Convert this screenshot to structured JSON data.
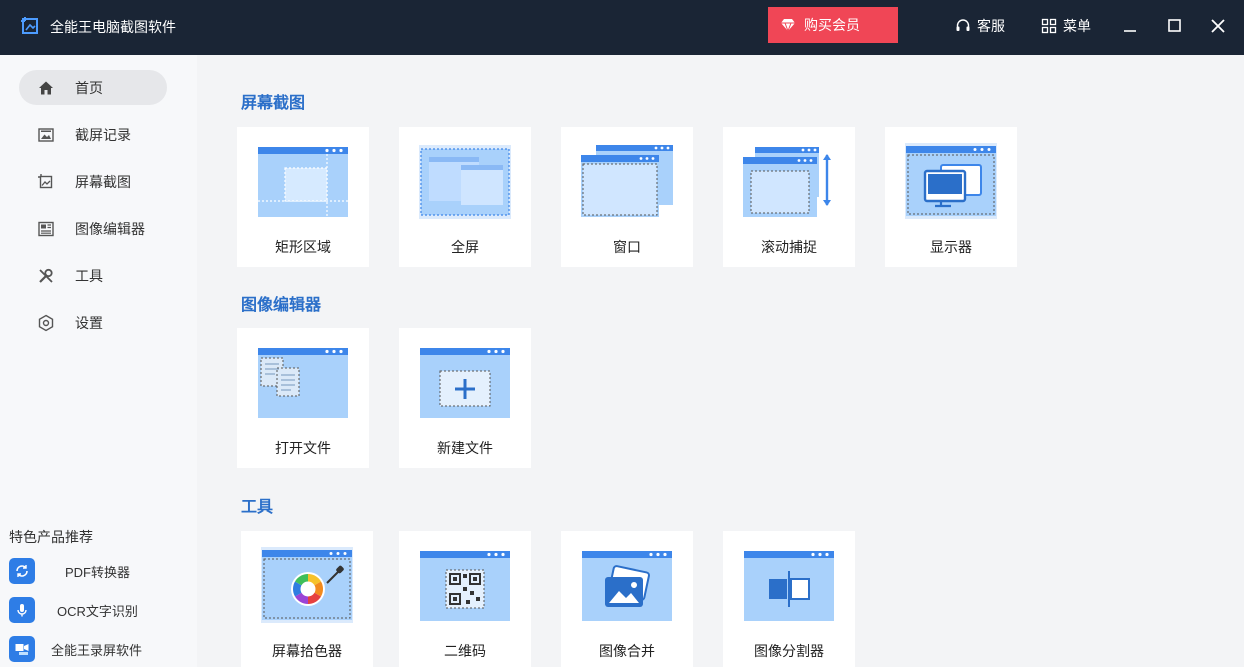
{
  "app": {
    "title": "全能王电脑截图软件",
    "vip_label": "购买会员",
    "service_label": "客服",
    "menu_label": "菜单"
  },
  "sidebar": {
    "items": [
      {
        "label": "首页",
        "icon": "home-icon",
        "active": true
      },
      {
        "label": "截屏记录",
        "icon": "history-icon"
      },
      {
        "label": "屏幕截图",
        "icon": "screenshot-icon"
      },
      {
        "label": "图像编辑器",
        "icon": "image-editor-icon"
      },
      {
        "label": "工具",
        "icon": "tools-icon"
      },
      {
        "label": "设置",
        "icon": "settings-icon"
      }
    ],
    "featured_title": "特色产品推荐",
    "featured": [
      {
        "label": "PDF转换器",
        "icon": "pdf-convert-icon"
      },
      {
        "label": "OCR文字识别",
        "icon": "microphone-icon"
      },
      {
        "label": "全能王录屏软件",
        "icon": "screen-record-icon"
      }
    ]
  },
  "main": {
    "sections": [
      {
        "title": "屏幕截图",
        "cards": [
          "矩形区域",
          "全屏",
          "窗口",
          "滚动捕捉",
          "显示器"
        ]
      },
      {
        "title": "图像编辑器",
        "cards": [
          "打开文件",
          "新建文件"
        ]
      },
      {
        "title": "工具",
        "cards": [
          "屏幕拾色器",
          "二维码",
          "图像合并",
          "图像分割器"
        ]
      }
    ]
  },
  "colors": {
    "titlebar": "#1a2535",
    "vip": "#f04656",
    "accent": "#2b6fc9",
    "illus_light": "#a9d1fb",
    "illus_bar": "#3d86ea"
  }
}
